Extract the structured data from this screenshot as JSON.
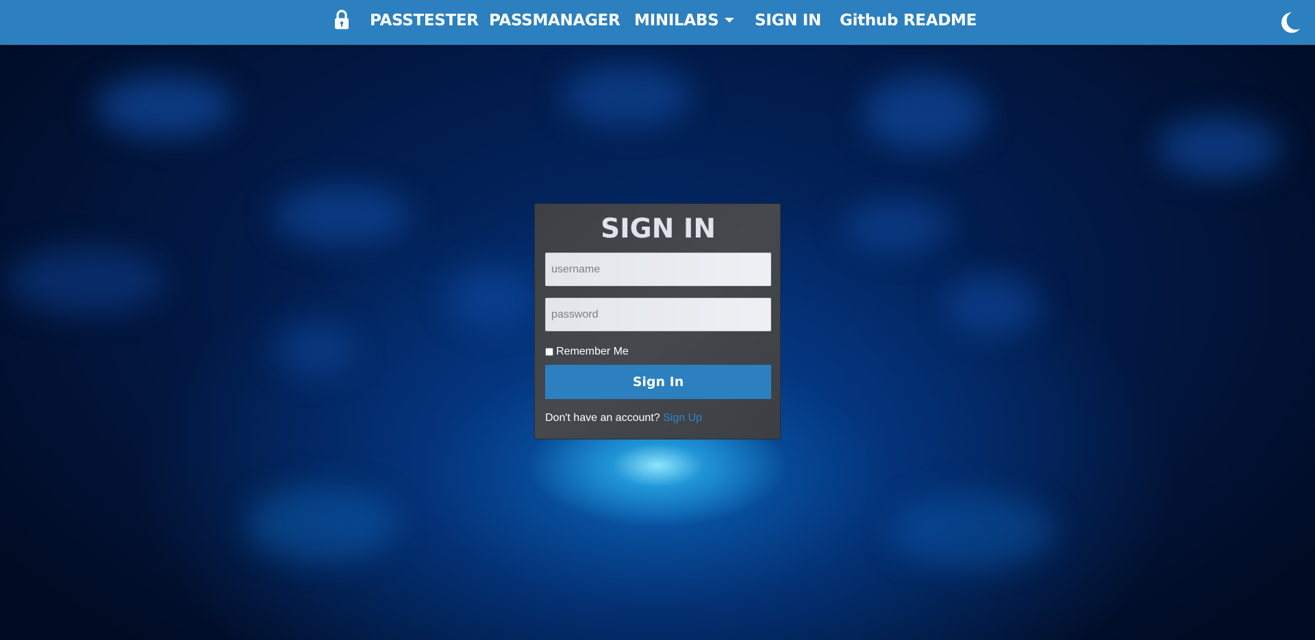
{
  "navbar": {
    "icon": "lock-icon",
    "links": [
      {
        "label": "PASSTESTER"
      },
      {
        "label": "PASSMANAGER"
      },
      {
        "label": "MINILABS"
      },
      {
        "label": "SIGN IN"
      },
      {
        "label": "Github README"
      }
    ],
    "theme_toggle_icon": "moon-icon"
  },
  "login": {
    "title": "SIGN IN",
    "username_placeholder": "username",
    "password_placeholder": "password",
    "remember_label": "Remember Me",
    "submit_label": "Sign In",
    "signup_prompt": "Don't have an account? ",
    "signup_link": "Sign Up"
  },
  "colors": {
    "navbar": "#2c80bf",
    "card": "#424549",
    "accent": "#2c80bf",
    "link": "#2f86c7"
  }
}
